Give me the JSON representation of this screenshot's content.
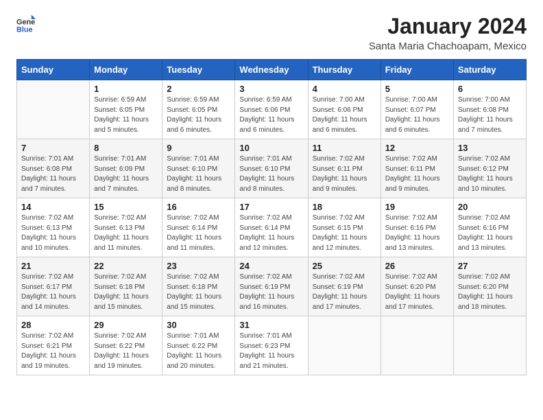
{
  "header": {
    "logo": {
      "general": "General",
      "blue": "Blue"
    },
    "title": "January 2024",
    "subtitle": "Santa Maria Chachoapam, Mexico"
  },
  "weekdays": [
    "Sunday",
    "Monday",
    "Tuesday",
    "Wednesday",
    "Thursday",
    "Friday",
    "Saturday"
  ],
  "weeks": [
    [
      {
        "day": "",
        "sunrise": "",
        "sunset": "",
        "daylight": ""
      },
      {
        "day": "1",
        "sunrise": "Sunrise: 6:59 AM",
        "sunset": "Sunset: 6:05 PM",
        "daylight": "Daylight: 11 hours and 5 minutes."
      },
      {
        "day": "2",
        "sunrise": "Sunrise: 6:59 AM",
        "sunset": "Sunset: 6:05 PM",
        "daylight": "Daylight: 11 hours and 6 minutes."
      },
      {
        "day": "3",
        "sunrise": "Sunrise: 6:59 AM",
        "sunset": "Sunset: 6:06 PM",
        "daylight": "Daylight: 11 hours and 6 minutes."
      },
      {
        "day": "4",
        "sunrise": "Sunrise: 7:00 AM",
        "sunset": "Sunset: 6:06 PM",
        "daylight": "Daylight: 11 hours and 6 minutes."
      },
      {
        "day": "5",
        "sunrise": "Sunrise: 7:00 AM",
        "sunset": "Sunset: 6:07 PM",
        "daylight": "Daylight: 11 hours and 6 minutes."
      },
      {
        "day": "6",
        "sunrise": "Sunrise: 7:00 AM",
        "sunset": "Sunset: 6:08 PM",
        "daylight": "Daylight: 11 hours and 7 minutes."
      }
    ],
    [
      {
        "day": "7",
        "sunrise": "Sunrise: 7:01 AM",
        "sunset": "Sunset: 6:08 PM",
        "daylight": "Daylight: 11 hours and 7 minutes."
      },
      {
        "day": "8",
        "sunrise": "Sunrise: 7:01 AM",
        "sunset": "Sunset: 6:09 PM",
        "daylight": "Daylight: 11 hours and 7 minutes."
      },
      {
        "day": "9",
        "sunrise": "Sunrise: 7:01 AM",
        "sunset": "Sunset: 6:10 PM",
        "daylight": "Daylight: 11 hours and 8 minutes."
      },
      {
        "day": "10",
        "sunrise": "Sunrise: 7:01 AM",
        "sunset": "Sunset: 6:10 PM",
        "daylight": "Daylight: 11 hours and 8 minutes."
      },
      {
        "day": "11",
        "sunrise": "Sunrise: 7:02 AM",
        "sunset": "Sunset: 6:11 PM",
        "daylight": "Daylight: 11 hours and 9 minutes."
      },
      {
        "day": "12",
        "sunrise": "Sunrise: 7:02 AM",
        "sunset": "Sunset: 6:11 PM",
        "daylight": "Daylight: 11 hours and 9 minutes."
      },
      {
        "day": "13",
        "sunrise": "Sunrise: 7:02 AM",
        "sunset": "Sunset: 6:12 PM",
        "daylight": "Daylight: 11 hours and 10 minutes."
      }
    ],
    [
      {
        "day": "14",
        "sunrise": "Sunrise: 7:02 AM",
        "sunset": "Sunset: 6:13 PM",
        "daylight": "Daylight: 11 hours and 10 minutes."
      },
      {
        "day": "15",
        "sunrise": "Sunrise: 7:02 AM",
        "sunset": "Sunset: 6:13 PM",
        "daylight": "Daylight: 11 hours and 11 minutes."
      },
      {
        "day": "16",
        "sunrise": "Sunrise: 7:02 AM",
        "sunset": "Sunset: 6:14 PM",
        "daylight": "Daylight: 11 hours and 11 minutes."
      },
      {
        "day": "17",
        "sunrise": "Sunrise: 7:02 AM",
        "sunset": "Sunset: 6:14 PM",
        "daylight": "Daylight: 11 hours and 12 minutes."
      },
      {
        "day": "18",
        "sunrise": "Sunrise: 7:02 AM",
        "sunset": "Sunset: 6:15 PM",
        "daylight": "Daylight: 11 hours and 12 minutes."
      },
      {
        "day": "19",
        "sunrise": "Sunrise: 7:02 AM",
        "sunset": "Sunset: 6:16 PM",
        "daylight": "Daylight: 11 hours and 13 minutes."
      },
      {
        "day": "20",
        "sunrise": "Sunrise: 7:02 AM",
        "sunset": "Sunset: 6:16 PM",
        "daylight": "Daylight: 11 hours and 13 minutes."
      }
    ],
    [
      {
        "day": "21",
        "sunrise": "Sunrise: 7:02 AM",
        "sunset": "Sunset: 6:17 PM",
        "daylight": "Daylight: 11 hours and 14 minutes."
      },
      {
        "day": "22",
        "sunrise": "Sunrise: 7:02 AM",
        "sunset": "Sunset: 6:18 PM",
        "daylight": "Daylight: 11 hours and 15 minutes."
      },
      {
        "day": "23",
        "sunrise": "Sunrise: 7:02 AM",
        "sunset": "Sunset: 6:18 PM",
        "daylight": "Daylight: 11 hours and 15 minutes."
      },
      {
        "day": "24",
        "sunrise": "Sunrise: 7:02 AM",
        "sunset": "Sunset: 6:19 PM",
        "daylight": "Daylight: 11 hours and 16 minutes."
      },
      {
        "day": "25",
        "sunrise": "Sunrise: 7:02 AM",
        "sunset": "Sunset: 6:19 PM",
        "daylight": "Daylight: 11 hours and 17 minutes."
      },
      {
        "day": "26",
        "sunrise": "Sunrise: 7:02 AM",
        "sunset": "Sunset: 6:20 PM",
        "daylight": "Daylight: 11 hours and 17 minutes."
      },
      {
        "day": "27",
        "sunrise": "Sunrise: 7:02 AM",
        "sunset": "Sunset: 6:20 PM",
        "daylight": "Daylight: 11 hours and 18 minutes."
      }
    ],
    [
      {
        "day": "28",
        "sunrise": "Sunrise: 7:02 AM",
        "sunset": "Sunset: 6:21 PM",
        "daylight": "Daylight: 11 hours and 19 minutes."
      },
      {
        "day": "29",
        "sunrise": "Sunrise: 7:02 AM",
        "sunset": "Sunset: 6:22 PM",
        "daylight": "Daylight: 11 hours and 19 minutes."
      },
      {
        "day": "30",
        "sunrise": "Sunrise: 7:01 AM",
        "sunset": "Sunset: 6:22 PM",
        "daylight": "Daylight: 11 hours and 20 minutes."
      },
      {
        "day": "31",
        "sunrise": "Sunrise: 7:01 AM",
        "sunset": "Sunset: 6:23 PM",
        "daylight": "Daylight: 11 hours and 21 minutes."
      },
      {
        "day": "",
        "sunrise": "",
        "sunset": "",
        "daylight": ""
      },
      {
        "day": "",
        "sunrise": "",
        "sunset": "",
        "daylight": ""
      },
      {
        "day": "",
        "sunrise": "",
        "sunset": "",
        "daylight": ""
      }
    ]
  ]
}
